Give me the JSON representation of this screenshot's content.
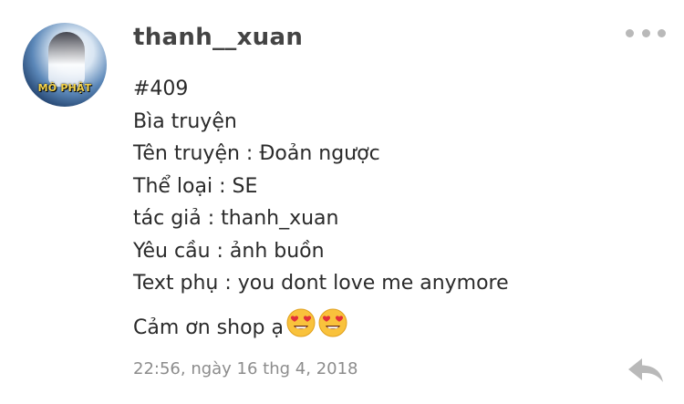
{
  "post": {
    "username": "thanh__xuan",
    "avatar_label": "MÔ PHẬT",
    "lines": [
      "#409",
      "Bìa truyện",
      "Tên truyện : Đoản ngược",
      "Thể loại : SE",
      "tác giả : thanh_xuan",
      "Yêu cầu : ảnh buồn",
      "Text phụ : you dont love me anymore"
    ],
    "closing": "Cảm ơn shop ạ",
    "emojis": [
      "heart-eyes-emoji",
      "heart-eyes-emoji"
    ],
    "timestamp": "22:56, ngày 16 thg 4, 2018"
  },
  "icons": {
    "more": "more-options-icon",
    "reply": "reply-arrow-icon"
  },
  "colors": {
    "username": "#444444",
    "text": "#2a2a2a",
    "timestamp": "#8c8c8c",
    "icons": "#b9b9b9",
    "avatar_label": "#f4d34a"
  }
}
